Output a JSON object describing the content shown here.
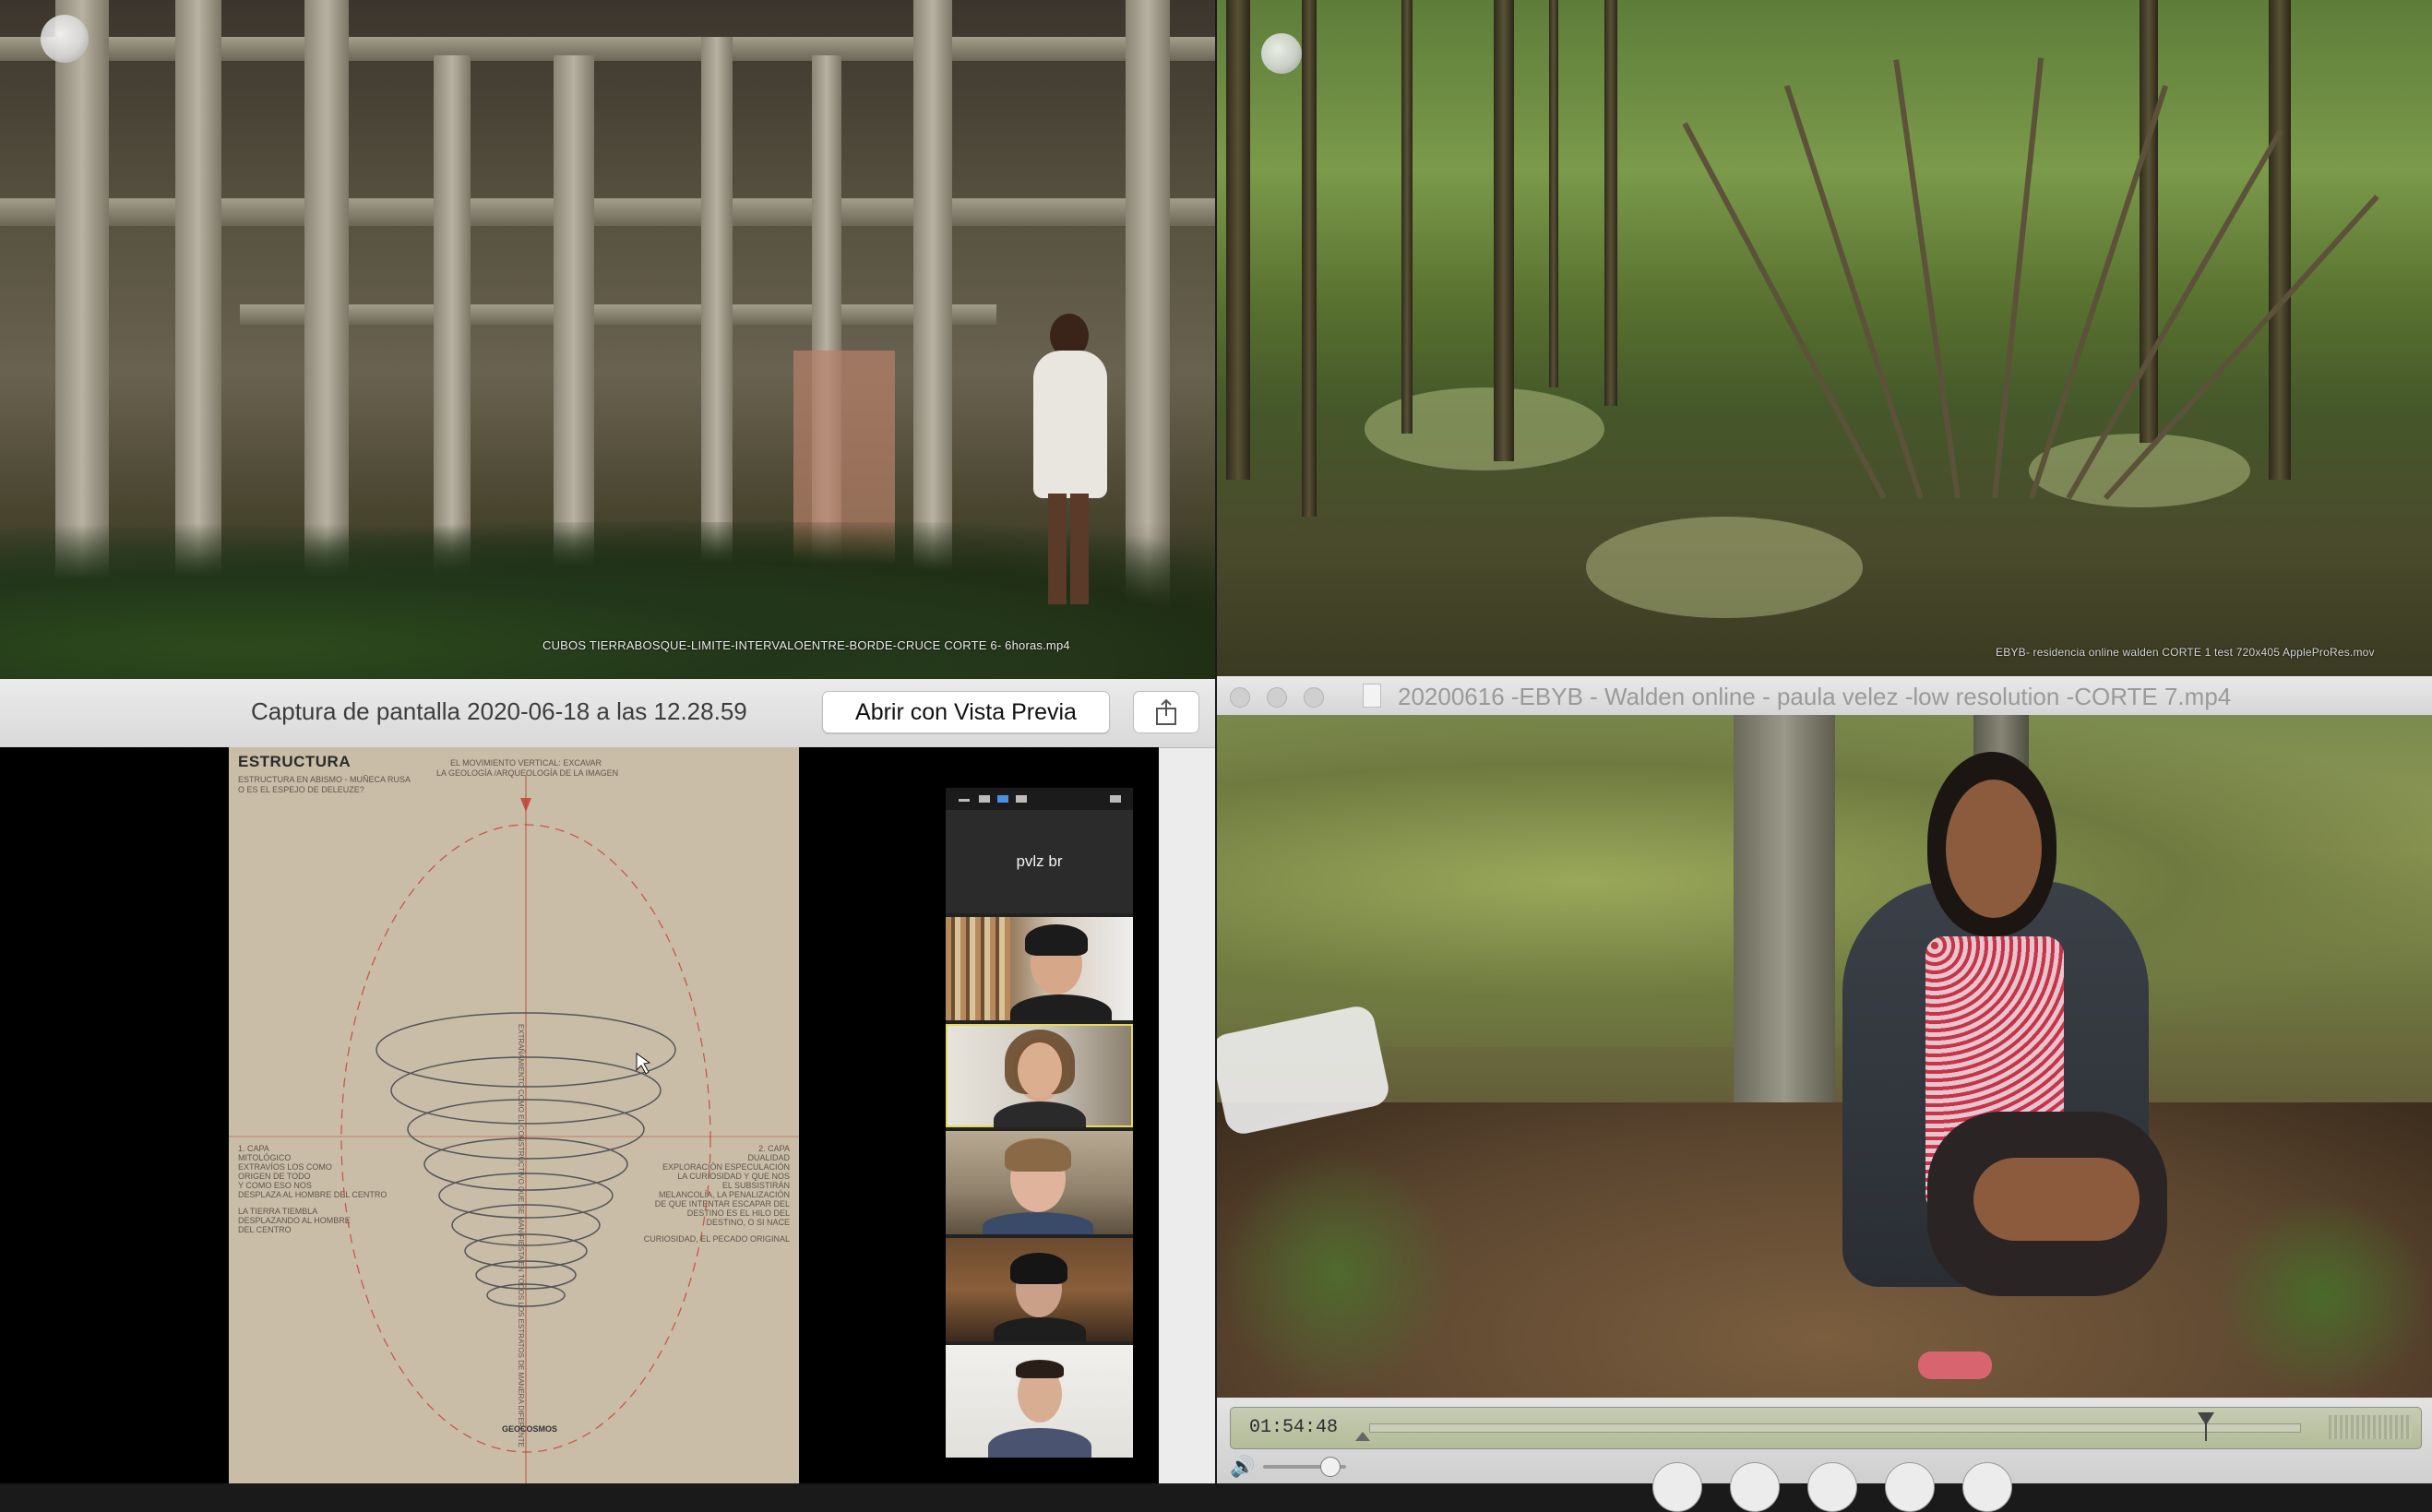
{
  "top_left_video": {
    "caption": "CUBOS TIERRABOSQUE-LIMITE-INTERVALOENTRE-BORDE-CRUCE CORTE 6- 6horas.mp4"
  },
  "top_right_video": {
    "caption": "EBYB- residencia online walden CORTE 1 test 720x405 AppleProRes.mov"
  },
  "preview_window": {
    "title": "Captura de pantalla 2020-06-18 a las 12.28.59",
    "open_button_label": "Abrir con Vista Previa",
    "share_icon": "share-icon",
    "slide": {
      "title": "ESTRUCTURA",
      "subtitle_line1": "ESTRUCTURA EN ABISMO - MUÑECA RUSA",
      "subtitle_line2": "O ES EL ESPEJO DE DELEUZE?",
      "top_note_line1": "EL MOVIMIENTO VERTICAL: EXCAVAR",
      "top_note_line2": "LA GEOLOGÍA /ARQUEOLOGÍA DE LA IMAGEN",
      "left_note_line1": "1. CAPA",
      "left_note_line2": "MITOLÓGICO",
      "left_note_line3": "EXTRAVÍOS LOS COMO",
      "left_note_line4": "ORIGEN DE TODO",
      "left_note_line5": "Y COMO ESO NOS",
      "left_note_line6": "DESPLAZA AL HOMBRE DEL CENTRO",
      "left_note_line7": "LA TIERRA TIEMBLA",
      "left_note_line8": "DESPLAZANDO AL HOMBRE",
      "left_note_line9": "DEL CENTRO",
      "right_note_line1": "2. CAPA",
      "right_note_line2": "DUALIDAD",
      "right_note_line3": "EXPLORACIÓN ESPECULACIÓN",
      "right_note_line4": "LA CURIOSIDAD Y QUE NOS",
      "right_note_line5": "EL SUBSISTIRÁN",
      "right_note_line6": "MELANCOLÍA, LA PENALIZACIÓN",
      "right_note_line7": "DE QUE INTENTAR ESCAPAR DEL",
      "right_note_line8": "DESTINO ES EL HILO DEL",
      "right_note_line9": "DESTINO, O SI NACE",
      "right_note_line10": "CURIOSIDAD, EL PECADO ORIGINAL",
      "vertical_text": "EXTRAÑAMIENTO COMO EL CONSTRUCTIVO QUE SE MANIFIESTA EN TODOS LOS ESTRATOS DE MANERA DIFERENTE",
      "bottom_label": "GEOCOSMOS"
    },
    "zoom": {
      "name_tile_label": "pvlz br"
    }
  },
  "quicktime": {
    "title": "20200616 -EBYB - Walden online - paula velez -low resolution -CORTE 7.mp4",
    "timecode": "01:54:48",
    "playback_progress": 0.9,
    "volume_level": 0.8
  }
}
